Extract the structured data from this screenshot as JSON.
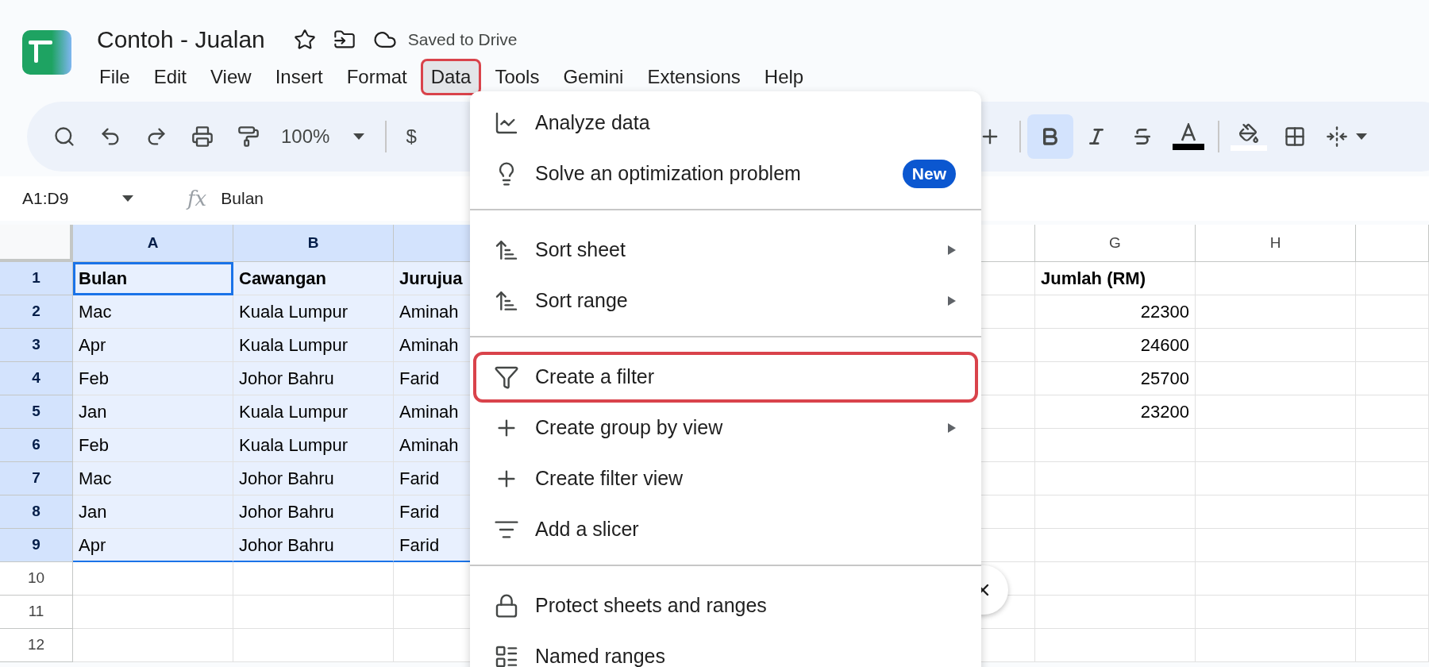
{
  "document": {
    "title": "Contoh - Jualan",
    "save_status": "Saved to Drive"
  },
  "menu_bar": [
    {
      "label": "File",
      "selected": false,
      "highlighted": false
    },
    {
      "label": "Edit",
      "selected": false,
      "highlighted": false
    },
    {
      "label": "View",
      "selected": false,
      "highlighted": false
    },
    {
      "label": "Insert",
      "selected": false,
      "highlighted": false
    },
    {
      "label": "Format",
      "selected": false,
      "highlighted": false
    },
    {
      "label": "Data",
      "selected": true,
      "highlighted": true
    },
    {
      "label": "Tools",
      "selected": false,
      "highlighted": false
    },
    {
      "label": "Gemini",
      "selected": false,
      "highlighted": false
    },
    {
      "label": "Extensions",
      "selected": false,
      "highlighted": false
    },
    {
      "label": "Help",
      "selected": false,
      "highlighted": false
    }
  ],
  "toolbar": {
    "zoom": "100%",
    "currency": "$",
    "bold": true,
    "italic": false,
    "strikethrough": false
  },
  "formula_bar": {
    "name_box": "A1:D9",
    "fx": "fx",
    "value": "Bulan"
  },
  "sheet": {
    "columns": [
      {
        "letter": "A",
        "selected": true
      },
      {
        "letter": "B",
        "selected": true
      },
      {
        "selected": true
      },
      {},
      {},
      {
        "selected": false
      },
      {
        "letter": "G",
        "selected": false
      },
      {
        "letter": "H",
        "selected": false
      },
      {
        "selected": false
      }
    ],
    "rows": [
      {
        "number": "1",
        "selected": true,
        "focused": true,
        "kind": "header",
        "cells": [
          "Bulan",
          "Cawangan",
          "Jurujua",
          "",
          "",
          "",
          "Jumlah (RM)"
        ]
      },
      {
        "number": "2",
        "selected": true,
        "focused": false,
        "kind": "data",
        "cells": [
          "Mac",
          "Kuala Lumpur",
          "Aminah",
          "",
          "",
          "",
          "22300"
        ]
      },
      {
        "number": "3",
        "selected": true,
        "focused": false,
        "kind": "data",
        "cells": [
          "Apr",
          "Kuala Lumpur",
          "Aminah",
          "",
          "",
          "",
          "24600"
        ]
      },
      {
        "number": "4",
        "selected": true,
        "focused": false,
        "kind": "data",
        "cells": [
          "Feb",
          "Johor Bahru",
          "Farid",
          "",
          "",
          "",
          "25700"
        ]
      },
      {
        "number": "5",
        "selected": true,
        "focused": false,
        "kind": "data",
        "cells": [
          "Jan",
          "Kuala Lumpur",
          "Aminah",
          "",
          "",
          "",
          "23200"
        ]
      },
      {
        "number": "6",
        "selected": true,
        "focused": false,
        "kind": "data",
        "cells": [
          "Feb",
          "Kuala Lumpur",
          "Aminah"
        ]
      },
      {
        "number": "7",
        "selected": true,
        "focused": false,
        "kind": "data",
        "cells": [
          "Mac",
          "Johor Bahru",
          "Farid"
        ]
      },
      {
        "number": "8",
        "selected": true,
        "focused": false,
        "kind": "data",
        "cells": [
          "Jan",
          "Johor Bahru",
          "Farid"
        ]
      },
      {
        "number": "9",
        "selected": true,
        "focused": false,
        "kind": "data",
        "cells": [
          "Apr",
          "Johor Bahru",
          "Farid"
        ]
      },
      {
        "number": "10",
        "selected": false,
        "kind": "data",
        "cells": []
      },
      {
        "number": "11",
        "selected": false,
        "kind": "data",
        "cells": []
      },
      {
        "number": "12",
        "selected": false,
        "kind": "data",
        "cells": []
      }
    ]
  },
  "data_menu": [
    {
      "kind": "item",
      "label": "Analyze data",
      "submenu": false,
      "highlighted": false
    },
    {
      "kind": "item",
      "label": "Solve an optimization problem",
      "badge": "New",
      "submenu": false,
      "highlighted": false
    },
    {
      "kind": "divider"
    },
    {
      "kind": "item",
      "label": "Sort sheet",
      "submenu": true,
      "highlighted": false
    },
    {
      "kind": "item",
      "label": "Sort range",
      "submenu": true,
      "highlighted": false
    },
    {
      "kind": "divider"
    },
    {
      "kind": "item",
      "label": "Create a filter",
      "submenu": false,
      "highlighted": true
    },
    {
      "kind": "item",
      "label": "Create group by view",
      "submenu": true,
      "highlighted": false
    },
    {
      "kind": "item",
      "label": "Create filter view",
      "submenu": false,
      "highlighted": false
    },
    {
      "kind": "item",
      "label": "Add a slicer",
      "submenu": false,
      "highlighted": false
    },
    {
      "kind": "divider"
    },
    {
      "kind": "item",
      "label": "Protect sheets and ranges",
      "submenu": false,
      "highlighted": false
    },
    {
      "kind": "item",
      "label": "Named ranges",
      "submenu": false,
      "highlighted": false
    }
  ]
}
